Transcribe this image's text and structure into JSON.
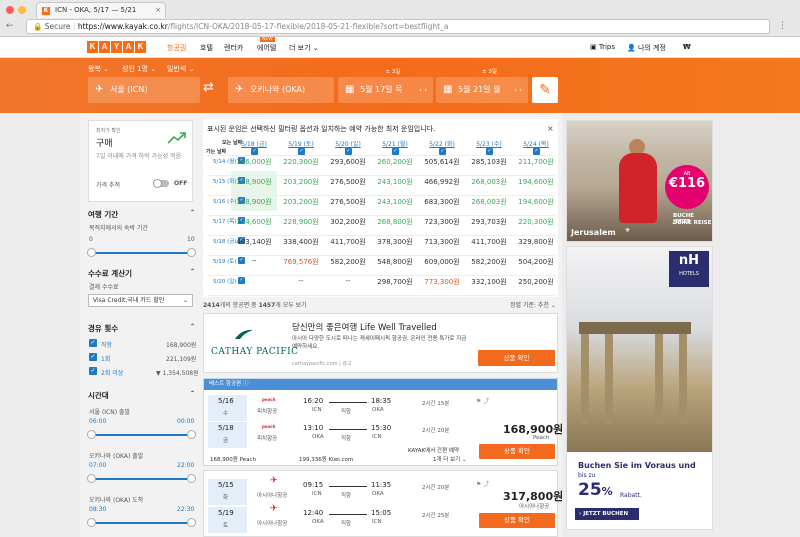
{
  "browser": {
    "tab_title": "ICN - OKA, 5/17 — 5/21",
    "secure": "Secure",
    "url_host": "https://www.kayak.co.kr",
    "url_path": "/flights/ICN-OKA/2018-05-17-flexible/2018-05-21-flexible?sort=bestflight_a"
  },
  "header": {
    "logo": [
      "K",
      "A",
      "Y",
      "A",
      "K"
    ],
    "nav": [
      "항공권",
      "호텔",
      "렌터카",
      "에어텔",
      "더 보기"
    ],
    "new_badge": "NEW",
    "trips": "Trips",
    "account": "나의 계정",
    "currency": "₩"
  },
  "search": {
    "trip_type": "왕복",
    "passengers": "성인 1명",
    "cabin": "일반석",
    "origin": "서울 (ICN)",
    "destination": "오키나와 (OKA)",
    "depart_flex": "± 3일",
    "depart": "5월 17일 목",
    "return_flex": "± 3일",
    "return": "5월 21일 월"
  },
  "sidebar": {
    "price_alert_title": "최저가 확인",
    "price_alert_action": "구매",
    "price_alert_desc": "7일 이내에 가격 하락 가능성 적음",
    "price_track": "가격 추적",
    "toggle": "OFF",
    "stay_title": "여행 기간",
    "stay_sub": "목적지에서의 숙박 기간",
    "stay_min": "0",
    "stay_max": "10",
    "fee_title": "수수료 계산기",
    "fee_sub": "결제 수수료",
    "fee_select": "Visa Credit,국내 카드 할인",
    "stops_title": "경유 횟수",
    "stops": [
      {
        "label": "직항",
        "price": "168,900원"
      },
      {
        "label": "1회",
        "price": "221,109원"
      },
      {
        "label": "2회 이상",
        "price": "1,354,508원"
      }
    ],
    "times_title": "시간대",
    "out_label": "서울 (ICN) 출발",
    "out_from": "06:00",
    "out_to": "00:00",
    "in_label": "오키나와 (OKA) 출발",
    "in_from": "07:00",
    "in_to": "22:00",
    "arr_label": "오키나와 (OKA) 도착",
    "arr_from": "08:30",
    "arr_to": "22:30"
  },
  "matrix": {
    "note": "표시된 운임은 선택하신 필터링 옵션과 일치하는 예약 가능한 최저 운임입니다.",
    "corner_top": "오는 날짜",
    "corner_bottom": "가는 날짜",
    "cols": [
      "5/18 (금)",
      "5/19 (토)",
      "5/20 (일)",
      "5/21 (월)",
      "5/22 (화)",
      "5/23 (수)",
      "5/24 (목)"
    ],
    "rows": [
      {
        "label": "5/14 (월)",
        "cells": [
          "186,000원",
          "220,300원",
          "293,600원",
          "260,200원",
          "505,614원",
          "285,103원",
          "211,700원"
        ]
      },
      {
        "label": "5/15 (화)",
        "cells": [
          "168,900원",
          "203,200원",
          "276,500원",
          "243,100원",
          "466,992원",
          "268,003원",
          "194,600원"
        ]
      },
      {
        "label": "5/16 (수)",
        "cells": [
          "168,900원",
          "203,200원",
          "276,500원",
          "243,100원",
          "683,300원",
          "268,003원",
          "194,600원"
        ]
      },
      {
        "label": "5/17 (목)",
        "cells": [
          "194,600원",
          "228,900원",
          "302,200원",
          "268,800원",
          "723,300원",
          "293,703원",
          "220,300원"
        ]
      },
      {
        "label": "5/18 (금)",
        "cells": [
          "403,140원",
          "338,400원",
          "411,700원",
          "378,300원",
          "713,300원",
          "411,700원",
          "329,800원"
        ]
      },
      {
        "label": "5/19 (토)",
        "cells": [
          "--",
          "769,576원",
          "582,200원",
          "548,800원",
          "609,000원",
          "582,200원",
          "504,200원"
        ]
      },
      {
        "label": "5/20 (일)",
        "cells": [
          "--",
          "--",
          "298,700원",
          "773,300원",
          "332,100원",
          "250,200원"
        ]
      }
    ]
  },
  "results_bar": {
    "count": "2414",
    "count_text": "개의 항공편 중",
    "shown": "1457",
    "shown_text": "개 모두 보기",
    "sort": "정렬 기준: 추천"
  },
  "ad": {
    "title": "당신만의 좋은여행 Life Well Travelled",
    "desc": "아시아 다양한 도시로 떠나는 캐세이패시픽 항공권. 온라인 전용 특가로 지금 예약하세요.",
    "brand": "CATHAY PACIFIC",
    "site": "cathaypacific.com",
    "ad_label": "광고",
    "button": "상품 확인"
  },
  "best": {
    "badge": "베스트 항공편",
    "outbound": {
      "date": "5/16",
      "day": "수",
      "airline": "피치항공",
      "dep": "16:20",
      "arr": "18:35",
      "from": "ICN",
      "type": "직항",
      "to": "OKA",
      "dur": "2시간 15분"
    },
    "inbound": {
      "date": "5/18",
      "day": "금",
      "airline": "피치항공",
      "dep": "13:10",
      "arr": "15:30",
      "from": "OKA",
      "type": "직항",
      "to": "ICN",
      "dur": "2시간 20분"
    },
    "price": "168,900원",
    "vendor": "Peach",
    "button": "상품 확인",
    "alt1_price": "168,900원",
    "alt1_vendor": "Peach",
    "alt2_price": "199,336원",
    "alt2_vendor": "Kiwi.com",
    "kayak_book": "KAYAK에서 간편 예약",
    "more": "1개 더 보기"
  },
  "second": {
    "outbound": {
      "date": "5/15",
      "day": "화",
      "airline": "아시아나항공",
      "dep": "09:15",
      "arr": "11:35",
      "from": "ICN",
      "type": "직항",
      "to": "OKA",
      "dur": "2시간 20분"
    },
    "inbound": {
      "date": "5/19",
      "day": "토",
      "airline": "아시아나항공",
      "dep": "12:40",
      "arr": "15:05",
      "from": "OKA",
      "type": "직항",
      "to": "ICN",
      "dur": "2시간 25분"
    },
    "price": "317,800원",
    "vendor": "아시아나항공",
    "button": "상품 확인"
  },
  "banner1": {
    "price_prefix": "AB",
    "price": "€116",
    "line1": "BUCHE JETZT",
    "line2": "DEINE REISE",
    "city": "Jerusalem"
  },
  "banner2": {
    "brand": "nH",
    "brand_sub": "HOTELS",
    "headline": "Buchen Sie im Voraus und",
    "bis": "bis zu",
    "pct": "25",
    "pct_sign": "%",
    "rabatt": "Rabatt.",
    "cta": "JETZT BUCHEN"
  },
  "colors": {
    "accent": "#ff690f",
    "blue": "#1e7ac4",
    "green": "#3aa757",
    "red": "#e0541c"
  }
}
